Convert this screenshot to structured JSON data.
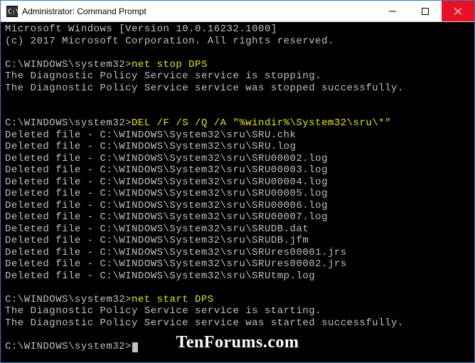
{
  "titlebar": {
    "title": "Administrator: Command Prompt"
  },
  "terminal": {
    "header1": "Microsoft Windows [Version 10.0.16232.1000]",
    "header2": "(c) 2017 Microsoft Corporation. All rights reserved.",
    "prompt1": "C:\\WINDOWS\\system32>",
    "cmd1": "net stop DPS",
    "out1a": "The Diagnostic Policy Service service is stopping.",
    "out1b": "The Diagnostic Policy Service service was stopped successfully.",
    "prompt2": "C:\\WINDOWS\\system32>",
    "cmd2": "DEL /F /S /Q /A \"%windir%\\System32\\sru\\*\"",
    "del_lines": [
      "Deleted file - C:\\WINDOWS\\System32\\sru\\SRU.chk",
      "Deleted file - C:\\WINDOWS\\System32\\sru\\SRU.log",
      "Deleted file - C:\\WINDOWS\\System32\\sru\\SRU00002.log",
      "Deleted file - C:\\WINDOWS\\System32\\sru\\SRU00003.log",
      "Deleted file - C:\\WINDOWS\\System32\\sru\\SRU00004.log",
      "Deleted file - C:\\WINDOWS\\System32\\sru\\SRU00005.log",
      "Deleted file - C:\\WINDOWS\\System32\\sru\\SRU00006.log",
      "Deleted file - C:\\WINDOWS\\System32\\sru\\SRU00007.log",
      "Deleted file - C:\\WINDOWS\\System32\\sru\\SRUDB.dat",
      "Deleted file - C:\\WINDOWS\\System32\\sru\\SRUDB.jfm",
      "Deleted file - C:\\WINDOWS\\System32\\sru\\SRUres00001.jrs",
      "Deleted file - C:\\WINDOWS\\System32\\sru\\SRUres00002.jrs",
      "Deleted file - C:\\WINDOWS\\System32\\sru\\SRUtmp.log"
    ],
    "prompt3": "C:\\WINDOWS\\system32>",
    "cmd3": "net start DPS",
    "out3a": "The Diagnostic Policy Service service is starting.",
    "out3b": "The Diagnostic Policy Service service was started successfully.",
    "prompt4": "C:\\WINDOWS\\system32>"
  },
  "watermark": "TenForums.com"
}
